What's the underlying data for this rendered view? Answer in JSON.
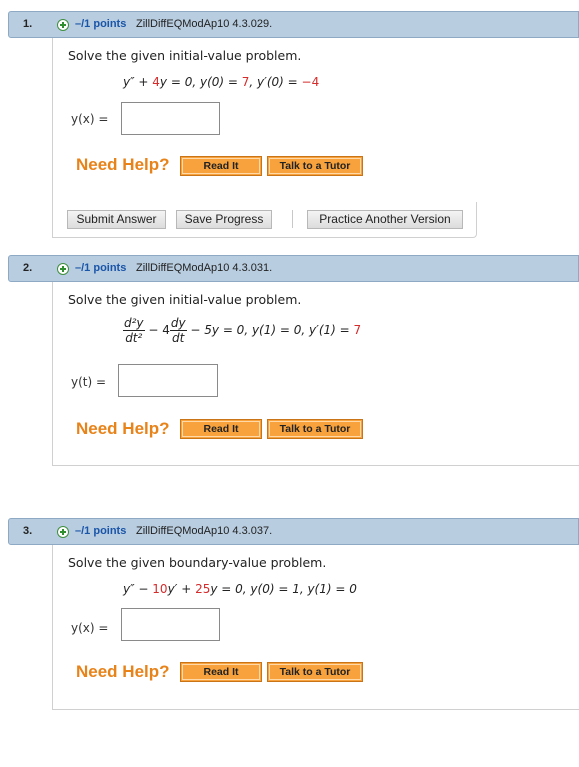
{
  "questions": [
    {
      "number": "1.",
      "points": "–/1 points",
      "code": "ZillDiffEQModAp10 4.3.029.",
      "prompt": "Solve the given initial-value problem.",
      "answer_label": "y(x) =",
      "answer_value": "",
      "need_help": "Need Help?",
      "read_it": "Read It",
      "talk_tutor": "Talk to a Tutor",
      "submit": "Submit Answer",
      "save": "Save Progress",
      "practice": "Practice Another Version"
    },
    {
      "number": "2.",
      "points": "–/1 points",
      "code": "ZillDiffEQModAp10 4.3.031.",
      "prompt": "Solve the given initial-value problem.",
      "answer_label": "y(t) =",
      "answer_value": "",
      "need_help": "Need Help?",
      "read_it": "Read It",
      "talk_tutor": "Talk to a Tutor"
    },
    {
      "number": "3.",
      "points": "–/1 points",
      "code": "ZillDiffEQModAp10 4.3.037.",
      "prompt": "Solve the given boundary-value problem.",
      "answer_label": "y(x) =",
      "answer_value": "",
      "need_help": "Need Help?",
      "read_it": "Read It",
      "talk_tutor": "Talk to a Tutor"
    }
  ],
  "equations": {
    "q1": {
      "a": "y″ + ",
      "c1": "4",
      "b": "y = 0,  y(0) = ",
      "c2": "7",
      "c": ",  y′(0) = ",
      "c3": "−4"
    },
    "q2": {
      "d2y": "d²y",
      "dt2": "dt²",
      "minus4": " − 4",
      "dy": "dy",
      "dt": "dt",
      "rest": " − 5y = 0,  y(1) = 0, y′(1) = ",
      "c1": "7"
    },
    "q3": {
      "a": "y″ − ",
      "c1": "10",
      "b": "y′ + ",
      "c2": "25",
      "c": "y = 0,  y(0) = 1,  y(1) = 0"
    }
  },
  "colors": {
    "header_bg": "#b8cde0",
    "points_blue": "#1a55a8",
    "help_orange": "#e8831a",
    "value_red": "#d42b2b"
  },
  "icons": [
    "plus-circle-icon"
  ]
}
